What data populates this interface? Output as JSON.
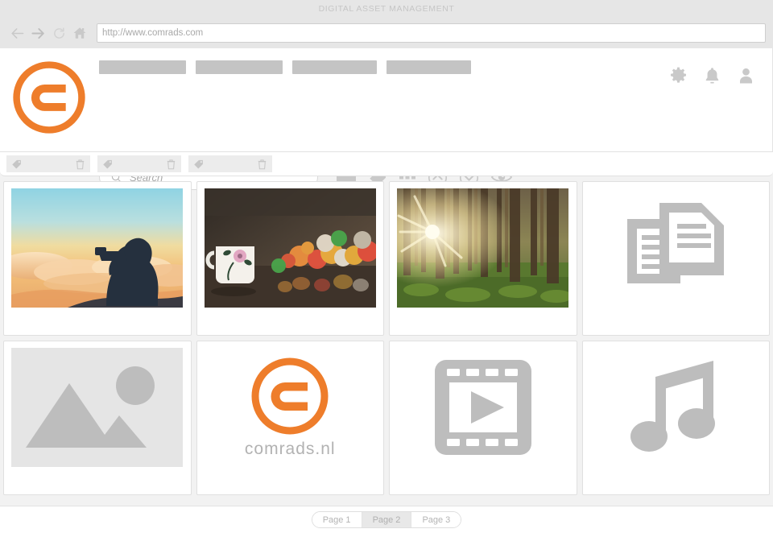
{
  "browser": {
    "title": "DIGITAL ASSET MANAGEMENT",
    "url": "http://www.comrads.com",
    "back_icon": "arrow-left-icon",
    "forward_icon": "arrow-right-icon",
    "reload_icon": "reload-icon",
    "home_icon": "home-icon"
  },
  "header": {
    "logo_alt": "comrads-logo",
    "nav_items": [
      {
        "label": ""
      },
      {
        "label": ""
      },
      {
        "label": ""
      },
      {
        "label": ""
      }
    ],
    "icons": [
      {
        "name": "gear-icon"
      },
      {
        "name": "bell-icon"
      },
      {
        "name": "user-icon"
      }
    ]
  },
  "search": {
    "placeholder": "Search",
    "value": "",
    "icon": "search-icon"
  },
  "toolbar": {
    "items": [
      {
        "name": "folder-icon"
      },
      {
        "name": "tag-icon"
      },
      {
        "name": "grid-view-icon"
      },
      {
        "name": "chevron-up-circle-icon"
      },
      {
        "name": "chevron-down-circle-icon"
      },
      {
        "name": "eye-icon"
      }
    ]
  },
  "tagbar": {
    "chips": [
      {
        "label": "",
        "tag_icon": "tag-icon",
        "delete_icon": "trash-icon"
      },
      {
        "label": "",
        "tag_icon": "tag-icon",
        "delete_icon": "trash-icon"
      },
      {
        "label": "",
        "tag_icon": "tag-icon",
        "delete_icon": "trash-icon"
      }
    ]
  },
  "assets": {
    "rows": [
      [
        {
          "type": "photo",
          "thumb": "photographer-silhouette-sunset",
          "label": ""
        },
        {
          "type": "photo",
          "thumb": "teacup-bokeh-lights",
          "label": ""
        },
        {
          "type": "photo",
          "thumb": "sunlit-forest",
          "label": ""
        },
        {
          "type": "document",
          "thumb": "document-icon",
          "label": ""
        }
      ],
      [
        {
          "type": "image-placeholder",
          "thumb": "image-placeholder-icon",
          "label": ""
        },
        {
          "type": "logo",
          "thumb": "comrads-logo",
          "label": "comrads.nl"
        },
        {
          "type": "video",
          "thumb": "video-film-icon",
          "label": ""
        },
        {
          "type": "audio",
          "thumb": "music-note-icon",
          "label": ""
        }
      ]
    ]
  },
  "pagination": {
    "pages": [
      {
        "label": "Page 1",
        "active": false
      },
      {
        "label": "Page 2",
        "active": true
      },
      {
        "label": "Page 3",
        "active": false
      }
    ]
  },
  "colors": {
    "brand_orange": "#ee7d2b",
    "chrome_gray": "#e6e6e6",
    "page_gray": "#f2f2f2",
    "icon_gray": "#c9c9c9",
    "placeholder_gray": "#bdbdbd"
  }
}
